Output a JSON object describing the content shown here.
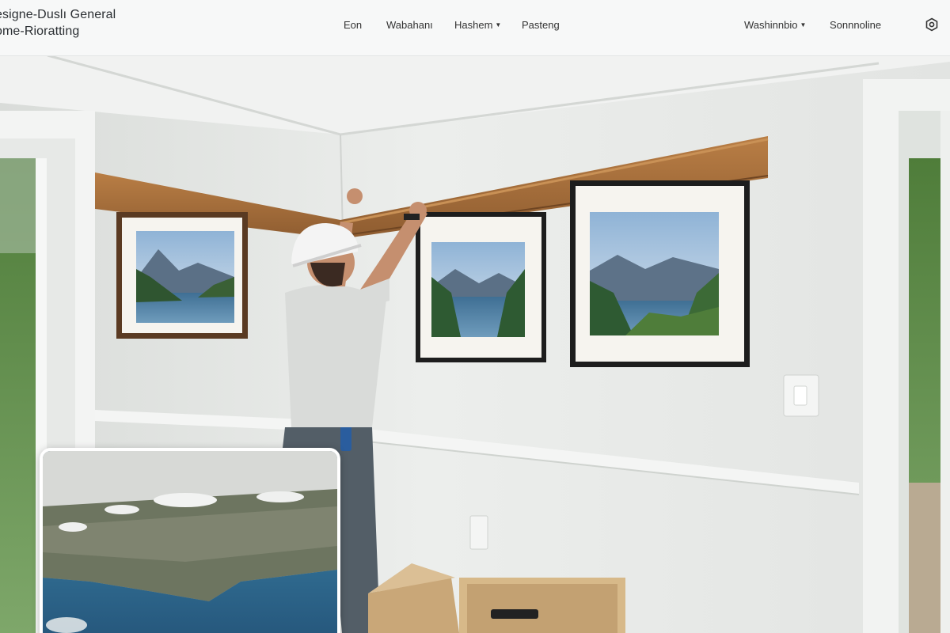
{
  "brand": {
    "line1": "esigne-Duslı General",
    "line2": "ome-Rioratting"
  },
  "nav": {
    "item1": "Eon",
    "item2": "Wabahanı",
    "item3": "Hashem",
    "item4": "Pasteng",
    "item5": "Washinnbio",
    "item6": "Sonnnoline"
  },
  "icons": {
    "settings": "gear-icon",
    "dropdown": "chevron-down-icon"
  },
  "colors": {
    "header_bg": "#f7f8f8",
    "wall": "#e6e8e6",
    "wood_trim": "#a06b3b"
  }
}
